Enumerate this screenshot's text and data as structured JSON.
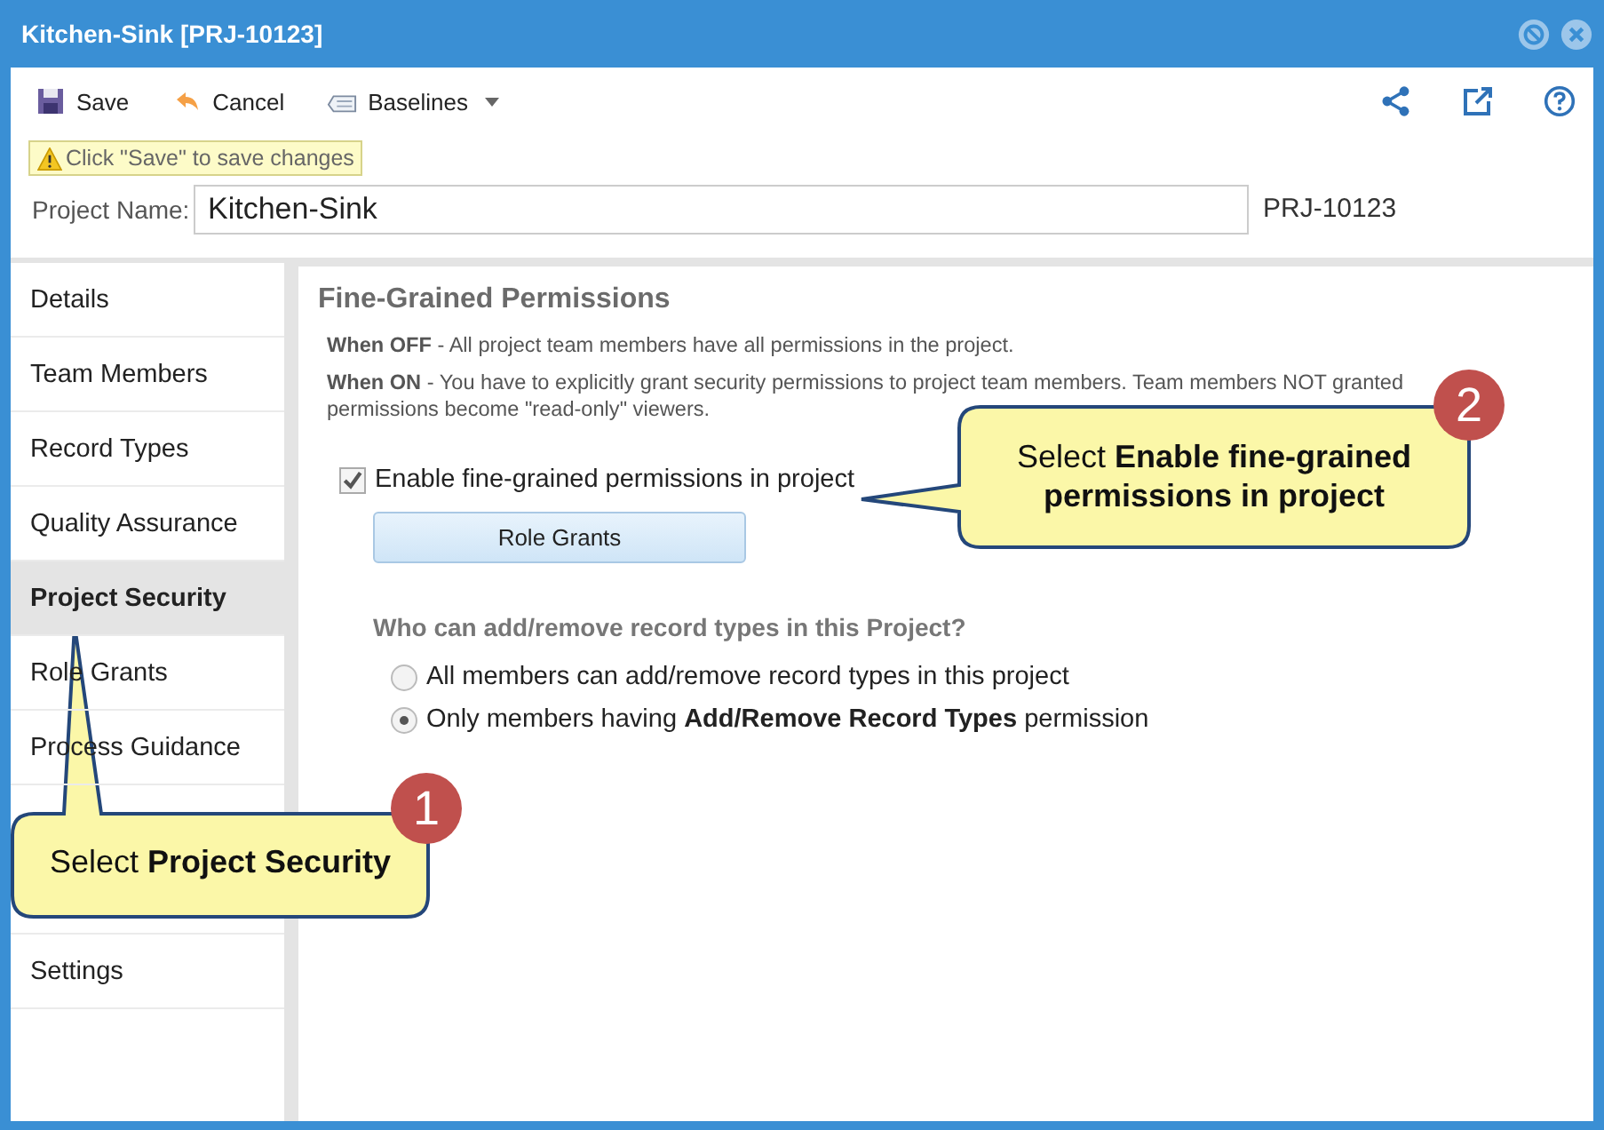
{
  "window": {
    "title": "Kitchen-Sink [PRJ-10123]"
  },
  "toolbar": {
    "buttons": [
      {
        "kind": "save",
        "label": "Save"
      },
      {
        "kind": "cancel",
        "label": "Cancel"
      },
      {
        "kind": "baselines",
        "label": "Baselines"
      }
    ]
  },
  "notice": "Click \"Save\" to save changes",
  "project_name": {
    "label": "Project Name:",
    "value": "Kitchen-Sink",
    "id": "PRJ-10123"
  },
  "sidebar": {
    "items": [
      {
        "label": "Details",
        "selected": false
      },
      {
        "label": "Team Members",
        "selected": false
      },
      {
        "label": "Record Types",
        "selected": false
      },
      {
        "label": "Quality Assurance",
        "selected": false
      },
      {
        "label": "Project Security",
        "selected": true
      },
      {
        "label": "Role Grants",
        "selected": false
      },
      {
        "label": "Process Guidance",
        "selected": false
      },
      {
        "label": "Settings",
        "selected": false
      }
    ]
  },
  "content": {
    "heading": "Fine-Grained Permissions",
    "notes": [
      "**When OFF** - All project team members have all permissions in the project.",
      "**When ON** - You have to explicitly grant security permissions to project team members. Team members NOT granted permissions become \"read-only\" viewers."
    ],
    "checkbox": {
      "label": "Enable fine-grained permissions in project",
      "checked": true
    },
    "role_grants_button": "Role Grants",
    "question": "Who can add/remove record types in this Project?",
    "radios": [
      {
        "label": "All members can add/remove record types in this project",
        "selected": false
      },
      {
        "label": "Only members having **Add/Remove Record Types** permission",
        "selected": true
      }
    ]
  },
  "callouts": [
    {
      "number": "2",
      "text": "Select **Enable fine-grained permissions in project**"
    },
    {
      "number": "1",
      "text": "Select **Project Security**"
    }
  ]
}
